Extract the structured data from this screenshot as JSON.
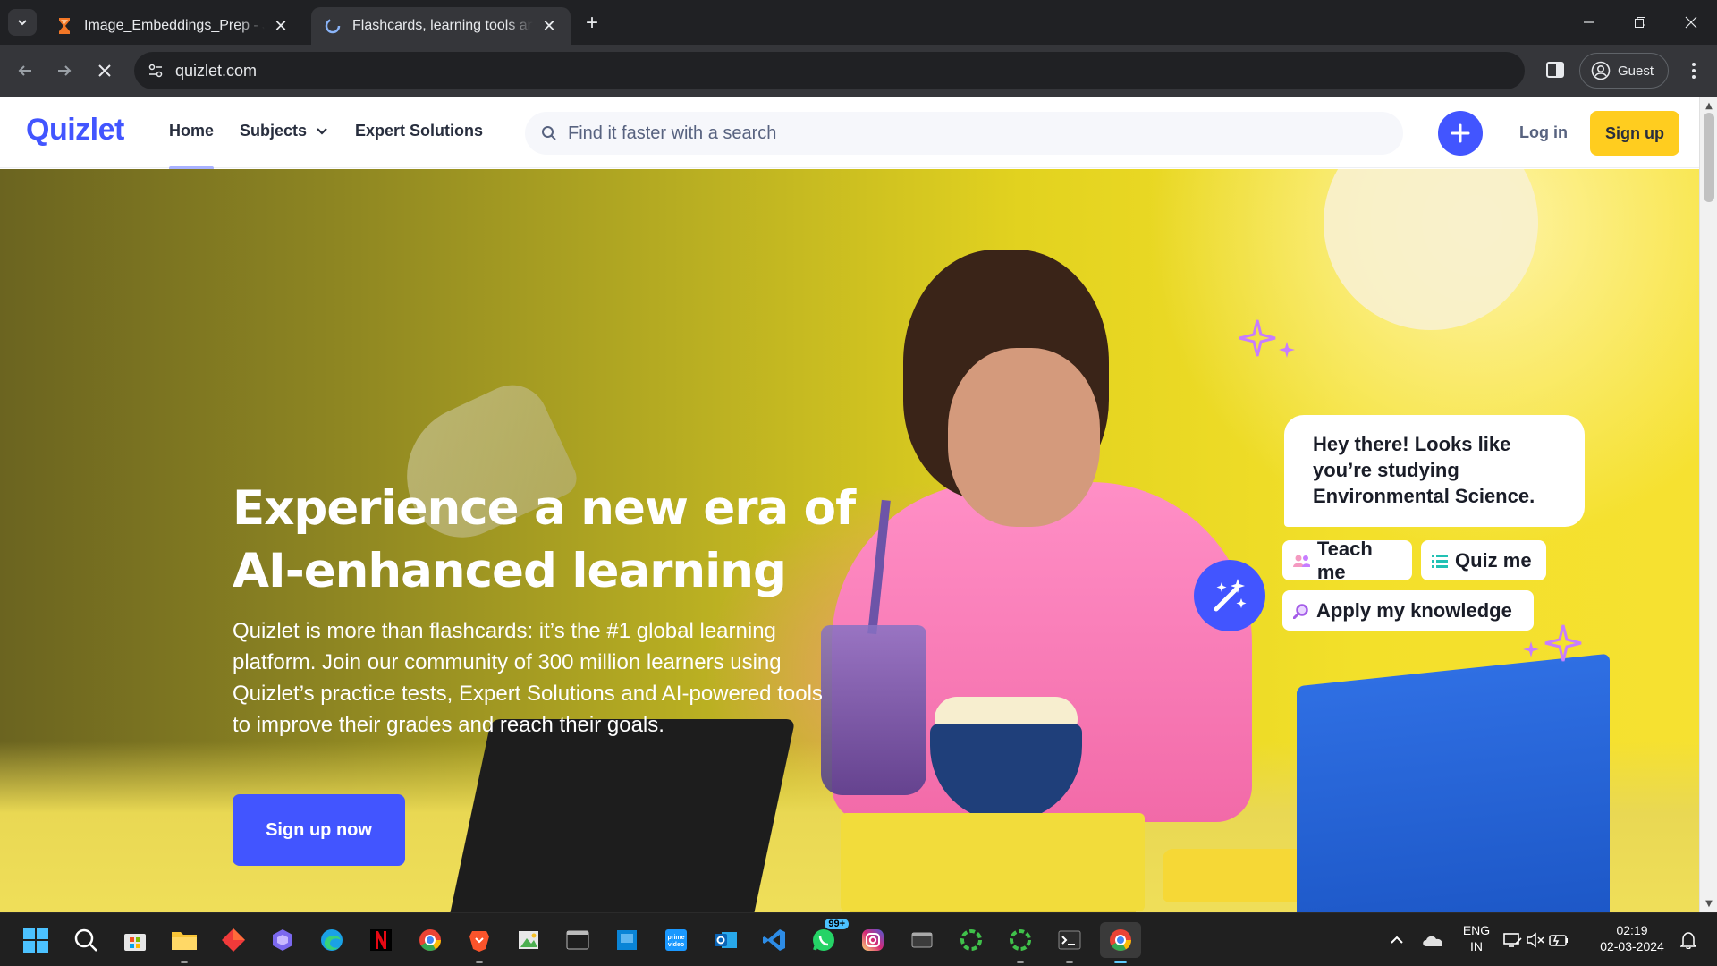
{
  "browser": {
    "tabs": [
      {
        "title": "Image_Embeddings_Prep - Jupyter",
        "active": false,
        "icon": "hourglass-icon"
      },
      {
        "title": "Flashcards, learning tools and textbook solutions",
        "active": true,
        "icon": "loading-icon"
      }
    ],
    "address": "quizlet.com",
    "profile_label": "Guest"
  },
  "quizlet": {
    "logo": "Quizlet",
    "nav": {
      "home": "Home",
      "subjects": "Subjects",
      "expert": "Expert Solutions"
    },
    "search_placeholder": "Find it faster with a search",
    "login": "Log in",
    "signup": "Sign up",
    "brand_color": "#4255ff",
    "accent_color": "#ffcd1f"
  },
  "hero": {
    "title_line1": "Experience a new era of",
    "title_line2": "AI-enhanced learning",
    "subtitle": "Quizlet is more than flashcards: it’s the #1 global learning platform. Join our community of 300 million learners using Quizlet’s practice tests, Expert Solutions and AI-powered tools to improve their grades and reach their goals.",
    "cta": "Sign up now",
    "chat_message": "Hey there! Looks like you’re studying Environmental Science.",
    "chips": {
      "teach": "Teach me",
      "quiz": "Quiz me",
      "apply": "Apply my knowledge"
    }
  },
  "taskbar": {
    "apps": [
      "start-icon",
      "search-icon",
      "store-icon",
      "file-explorer-icon",
      "app-red-icon",
      "copilot-icon",
      "edge-icon",
      "netflix-icon",
      "chrome-icon",
      "brave-icon",
      "image-viewer-icon",
      "terminal-window-icon",
      "app-blue-icon",
      "prime-video-icon",
      "outlook-icon",
      "vscode-icon",
      "whatsapp-icon",
      "instagram-icon",
      "app-window-icon",
      "spinner-green-icon",
      "spinner-green-2-icon",
      "terminal-icon",
      "chrome-active-icon"
    ],
    "whatsapp_badge": "99+",
    "language": "ENG",
    "region": "IN",
    "time": "02:19",
    "date": "02-03-2024"
  }
}
